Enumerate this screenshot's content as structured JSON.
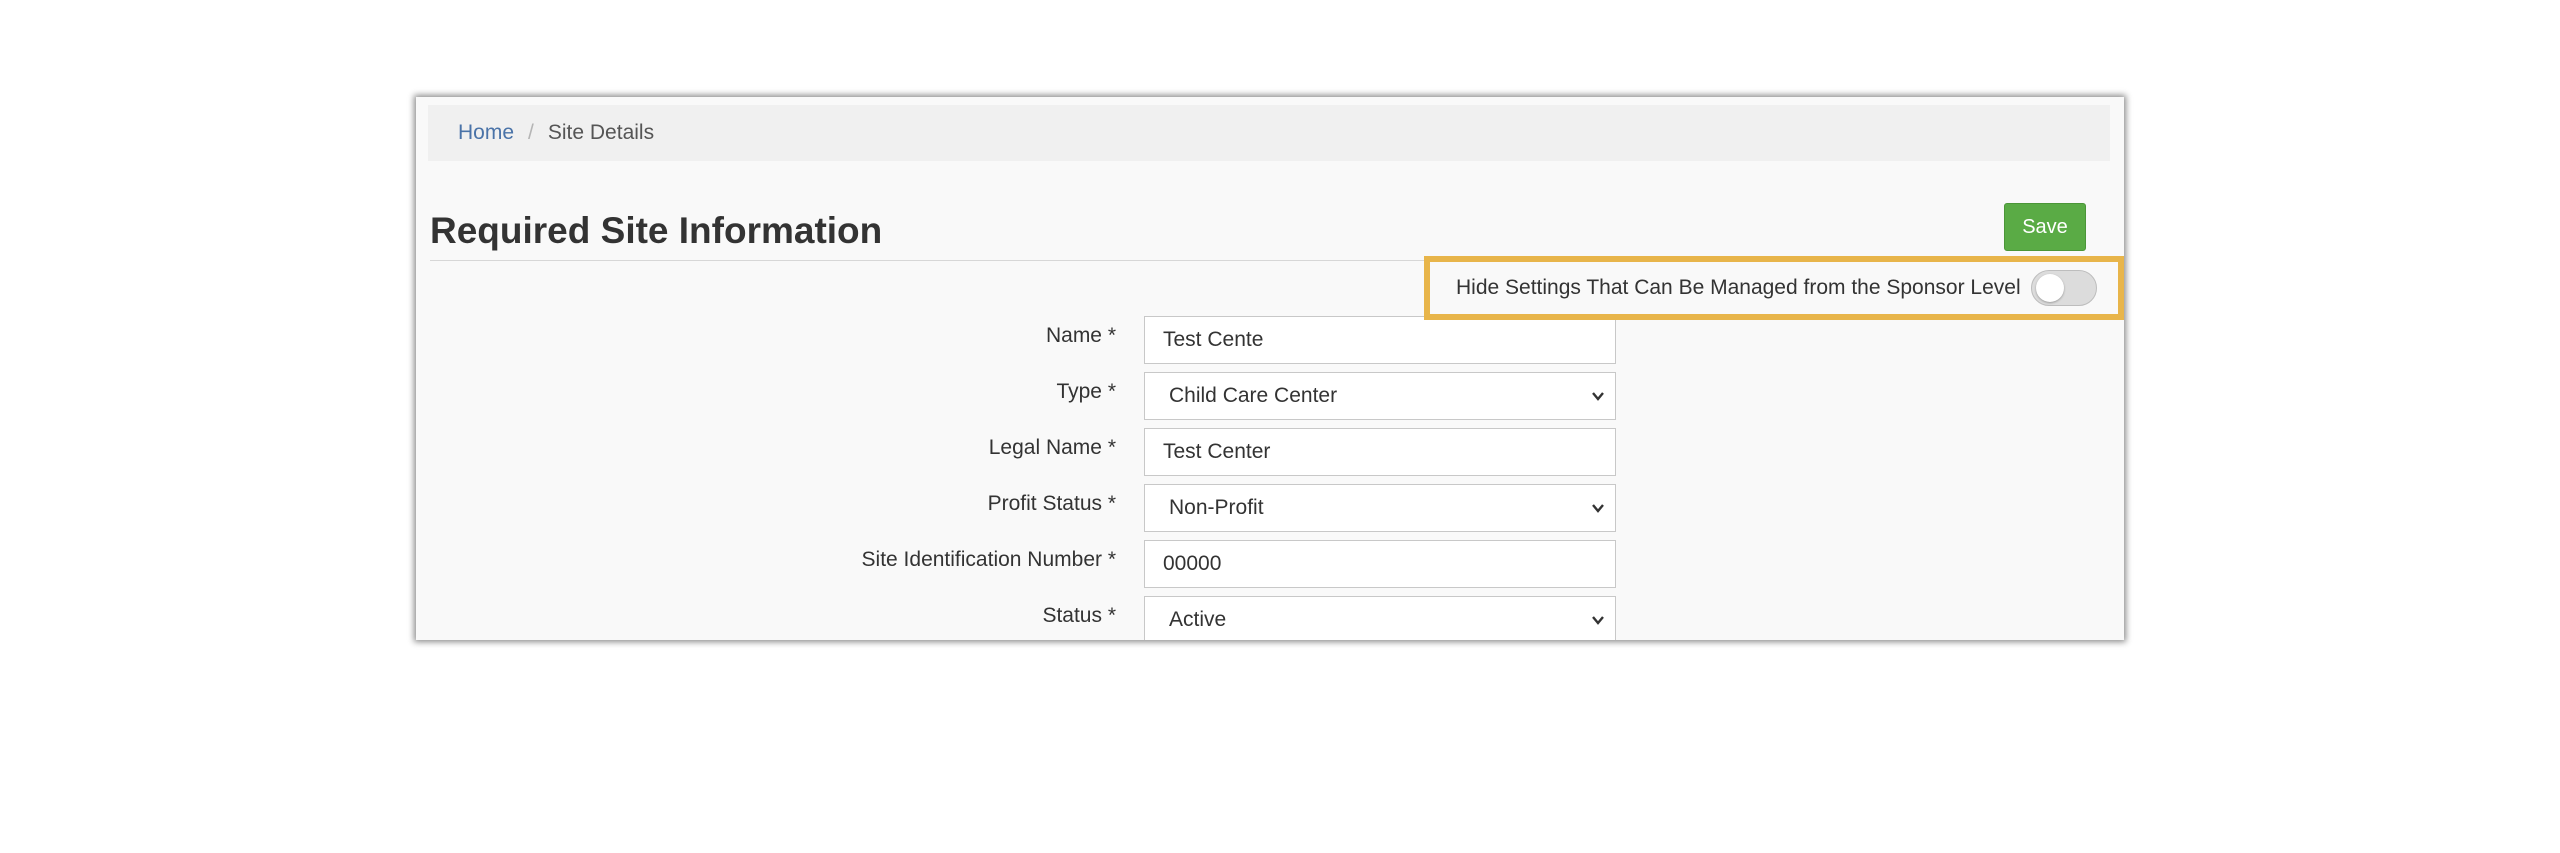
{
  "breadcrumb": {
    "home": "Home",
    "separator": "/",
    "current": "Site Details"
  },
  "page": {
    "title": "Required Site Information",
    "save_label": "Save"
  },
  "toggle": {
    "label": "Hide Settings That Can Be Managed from the Sponsor Level",
    "state": "off"
  },
  "form": {
    "name": {
      "label": "Name *",
      "value": "Test Cente"
    },
    "type": {
      "label": "Type *",
      "value": "Child Care Center"
    },
    "legal_name": {
      "label": "Legal Name *",
      "value": "Test Center"
    },
    "profit_status": {
      "label": "Profit Status *",
      "value": "Non-Profit"
    },
    "site_id": {
      "label": "Site Identification Number *",
      "value": "00000"
    },
    "status": {
      "label": "Status *",
      "value": "Active"
    }
  },
  "colors": {
    "save_button": "#5aab45",
    "highlight": "#e8b54a",
    "link": "#4a73a8"
  },
  "icons": {
    "select_arrow": "chevron-down-icon"
  }
}
